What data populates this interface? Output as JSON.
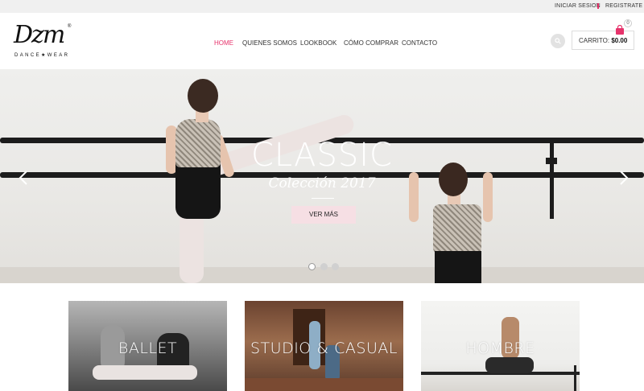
{
  "topbar": {
    "login": "INICIAR SESION",
    "register": "REGISTRATE"
  },
  "logo": {
    "mark": "Dzm",
    "registered": "®",
    "sub": "DANCE★WEAR"
  },
  "nav": [
    {
      "label": "HOME",
      "active": true
    },
    {
      "label": "QUIENES SOMOS",
      "active": false
    },
    {
      "label": "LOOKBOOK",
      "active": false
    },
    {
      "label": "CÓMO COMPRAR",
      "active": false
    },
    {
      "label": "CONTACTO",
      "active": false
    }
  ],
  "cart": {
    "label": "CARRITO:",
    "amount": "$0.00",
    "count": "0"
  },
  "hero": {
    "title": "CLASSIC",
    "subtitle": "Colección 2017",
    "button": "VER MÁS",
    "slides_total": 3,
    "slide_active": 1
  },
  "categories": [
    {
      "label": "BALLET"
    },
    {
      "label": "STUDIO & CASUAL"
    },
    {
      "label": "HOMBRE"
    }
  ],
  "colors": {
    "accent": "#e6336b",
    "button_bg": "#f6dfe4",
    "topbar_bg": "#f0f0f0"
  }
}
